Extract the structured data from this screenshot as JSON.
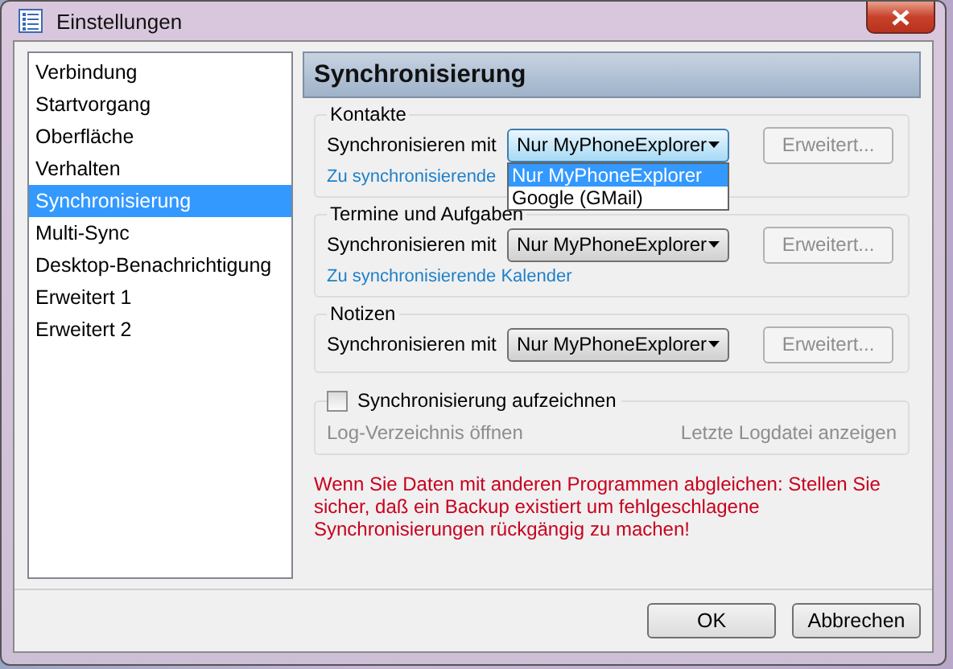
{
  "window": {
    "title": "Einstellungen"
  },
  "sidebar": {
    "items": [
      {
        "label": "Verbindung",
        "selected": false
      },
      {
        "label": "Startvorgang",
        "selected": false
      },
      {
        "label": "Oberfläche",
        "selected": false
      },
      {
        "label": "Verhalten",
        "selected": false
      },
      {
        "label": "Synchronisierung",
        "selected": true
      },
      {
        "label": "Multi-Sync",
        "selected": false
      },
      {
        "label": "Desktop-Benachrichtigung",
        "selected": false
      },
      {
        "label": "Erweitert 1",
        "selected": false
      },
      {
        "label": "Erweitert 2",
        "selected": false
      }
    ]
  },
  "panel": {
    "title": "Synchronisierung",
    "groups": [
      {
        "title": "Kontakte",
        "label": "Synchronisieren mit",
        "select": {
          "value": "Nur MyPhoneExplorer",
          "open": true,
          "options": [
            {
              "label": "Nur MyPhoneExplorer",
              "selected": true
            },
            {
              "label": "Google (GMail)",
              "selected": false
            }
          ]
        },
        "button": {
          "label": "Erweitert...",
          "disabled": true
        },
        "link": "Zu synchronisierende"
      },
      {
        "title": "Termine und Aufgaben",
        "label": "Synchronisieren mit",
        "select": {
          "value": "Nur MyPhoneExplorer",
          "open": false
        },
        "button": {
          "label": "Erweitert...",
          "disabled": true
        },
        "link": "Zu synchronisierende Kalender"
      },
      {
        "title": "Notizen",
        "label": "Synchronisieren mit",
        "select": {
          "value": "Nur MyPhoneExplorer",
          "open": false
        },
        "button": {
          "label": "Erweitert...",
          "disabled": true
        }
      }
    ],
    "log": {
      "checkbox": {
        "label": "Synchronisierung aufzeichnen",
        "checked": false
      },
      "links": [
        {
          "label": "Log-Verzeichnis öffnen",
          "disabled": true
        },
        {
          "label": "Letzte Logdatei anzeigen",
          "disabled": true
        }
      ]
    },
    "warning": "Wenn Sie Daten mit anderen Programmen abgleichen: Stellen Sie sicher, daß ein Backup existiert um fehlgeschlagene Synchronisierungen rückgängig zu machen!"
  },
  "buttons": [
    {
      "label": "OK"
    },
    {
      "label": "Abbrechen"
    }
  ]
}
